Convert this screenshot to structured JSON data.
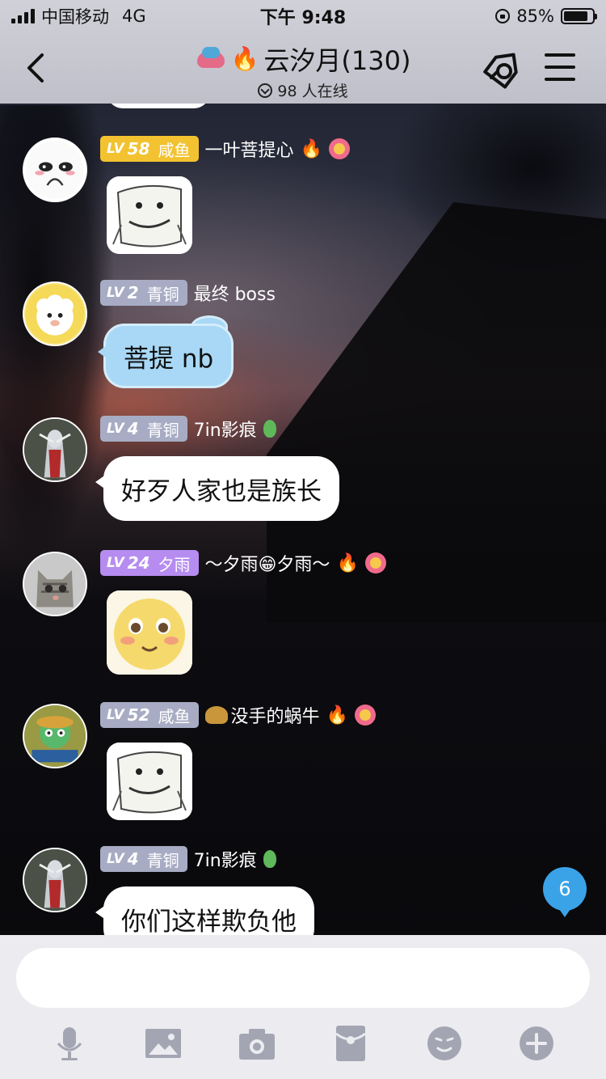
{
  "status_bar": {
    "carrier": "中国移动",
    "network": "4G",
    "time": "下午 9:48",
    "battery": "85%",
    "battery_level": 0.85
  },
  "header": {
    "title": "云汐月(130)",
    "online": "98 人在线",
    "icons": [
      "back-icon",
      "group-icon",
      "fire-icon",
      "tag-icon",
      "menu-icon"
    ]
  },
  "messages": [
    {
      "level": "LV",
      "level_num": "58",
      "title": "咸鱼",
      "badge_color": "#f2c230",
      "nickname": "一叶菩提心",
      "content_type": "sticker"
    },
    {
      "level": "LV",
      "level_num": "2",
      "title": "青铜",
      "badge_color": "#a7acc4",
      "nickname": "最终 boss",
      "content_type": "text",
      "text": "菩提 nb"
    },
    {
      "level": "LV",
      "level_num": "4",
      "title": "青铜",
      "badge_color": "#a7acc4",
      "nickname": "7in影痕",
      "content_type": "text",
      "text": "好歹人家也是族长"
    },
    {
      "level": "LV",
      "level_num": "24",
      "title": "夕雨",
      "badge_color": "#b68cf0",
      "nickname": "～夕雨😁夕雨～",
      "content_type": "sticker"
    },
    {
      "level": "LV",
      "level_num": "52",
      "title": "咸鱼",
      "badge_color": "#a7acc4",
      "nickname": "没手的蜗牛",
      "content_type": "sticker"
    },
    {
      "level": "LV",
      "level_num": "4",
      "title": "青铜",
      "badge_color": "#a7acc4",
      "nickname": "7in影痕",
      "content_type": "text",
      "text": "你们这样欺负他"
    }
  ],
  "unread_count": "6",
  "input": {
    "placeholder": ""
  },
  "toolbar": [
    "mic-icon",
    "image-icon",
    "camera-icon",
    "red-packet-icon",
    "emoji-icon",
    "plus-icon"
  ]
}
